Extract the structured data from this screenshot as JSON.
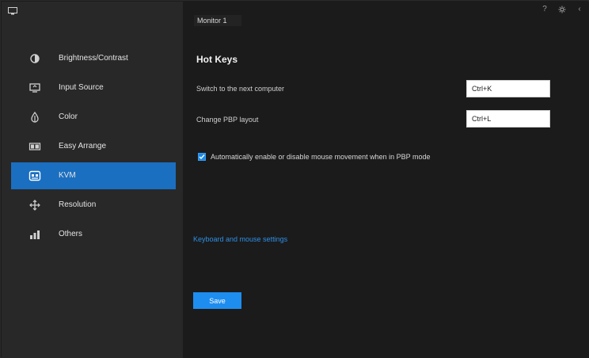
{
  "colors": {
    "sidebar_bg": "#282828",
    "main_bg": "#1b1b1b",
    "accent": "#1b6fc0",
    "button": "#1e8df0",
    "link": "#2e8fe6"
  },
  "sidebar": {
    "items": [
      {
        "label": "Brightness/Contrast",
        "icon": "sun-icon"
      },
      {
        "label": "Input Source",
        "icon": "input-source-icon"
      },
      {
        "label": "Color",
        "icon": "color-icon"
      },
      {
        "label": "Easy Arrange",
        "icon": "easy-arrange-icon"
      },
      {
        "label": "KVM",
        "icon": "kvm-icon",
        "active": true
      },
      {
        "label": "Resolution",
        "icon": "resolution-icon"
      },
      {
        "label": "Others",
        "icon": "others-icon"
      }
    ]
  },
  "header": {
    "device_name": "Monitor 1",
    "help_label": "?",
    "settings_icon": "gear-icon",
    "collapse_label": "‹"
  },
  "main": {
    "section_title": "Hot Keys",
    "fields": [
      {
        "label": "Switch to the next computer",
        "value": "Ctrl+K"
      },
      {
        "label": "Change PBP layout",
        "value": "Ctrl+L"
      }
    ],
    "checkbox": {
      "checked": true,
      "label": "Automatically enable or disable mouse movement when in PBP mode"
    },
    "link_text": "Keyboard and mouse settings",
    "apply_label": "Save"
  }
}
